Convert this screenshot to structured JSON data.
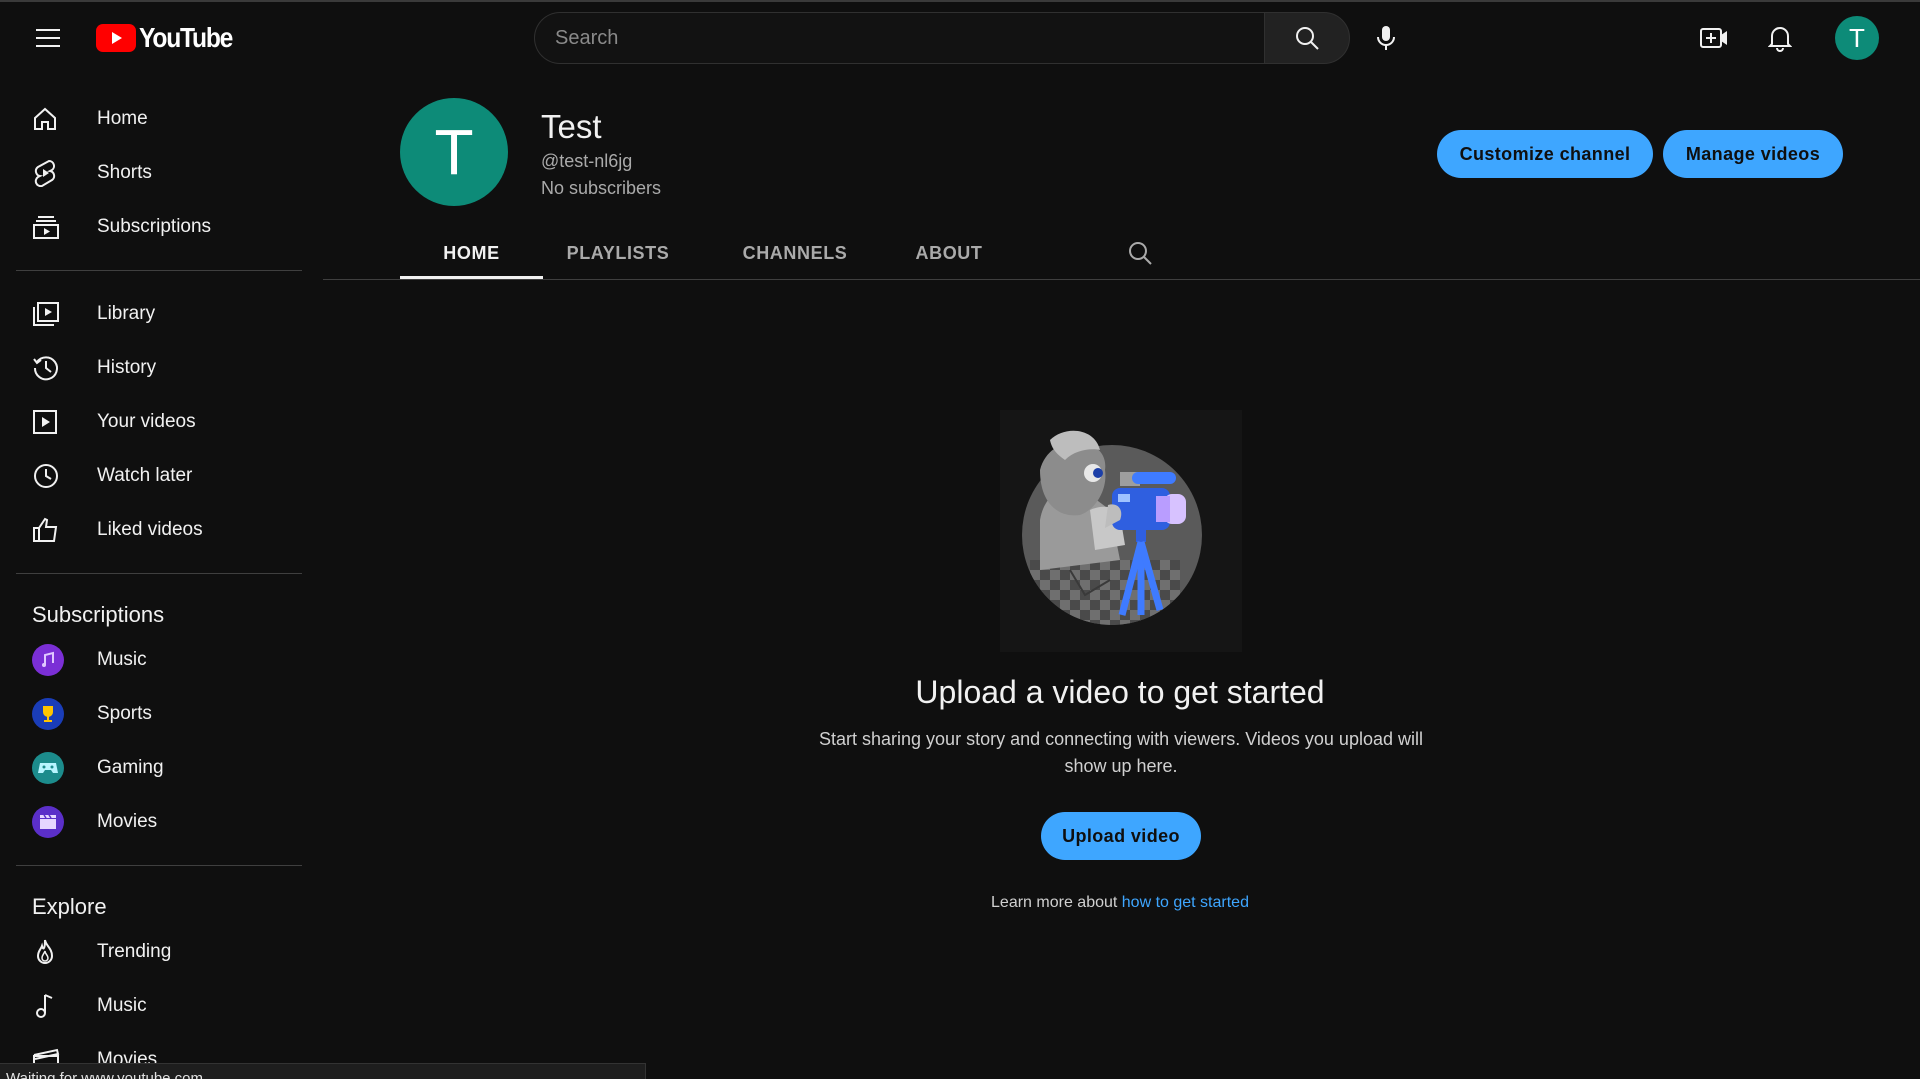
{
  "header": {
    "logo_text": "YouTube",
    "search_placeholder": "Search"
  },
  "user": {
    "avatar_initial": "T"
  },
  "sidebar": {
    "main": [
      {
        "label": "Home",
        "icon": "home-icon"
      },
      {
        "label": "Shorts",
        "icon": "shorts-icon"
      },
      {
        "label": "Subscriptions",
        "icon": "subscriptions-icon"
      }
    ],
    "you": [
      {
        "label": "Library",
        "icon": "library-icon"
      },
      {
        "label": "History",
        "icon": "history-icon"
      },
      {
        "label": "Your videos",
        "icon": "your-videos-icon"
      },
      {
        "label": "Watch later",
        "icon": "watch-later-icon"
      },
      {
        "label": "Liked videos",
        "icon": "like-icon"
      }
    ],
    "subscriptions_title": "Subscriptions",
    "subscriptions": [
      {
        "label": "Music",
        "color": "#7b2fd6"
      },
      {
        "label": "Sports",
        "color": "#1a3db8"
      },
      {
        "label": "Gaming",
        "color": "#1c8c8c"
      },
      {
        "label": "Movies",
        "color": "#5b2fc9"
      }
    ],
    "explore_title": "Explore",
    "explore": [
      {
        "label": "Trending",
        "icon": "trending-icon"
      },
      {
        "label": "Music",
        "icon": "music-note-icon"
      },
      {
        "label": "Movies",
        "icon": "movies-icon"
      }
    ]
  },
  "channel": {
    "avatar_initial": "T",
    "name": "Test",
    "handle": "@test-nl6jg",
    "subscribers": "No subscribers",
    "customize_label": "Customize channel",
    "manage_label": "Manage videos",
    "tabs": [
      "HOME",
      "PLAYLISTS",
      "CHANNELS",
      "ABOUT"
    ],
    "active_tab": "HOME"
  },
  "empty_state": {
    "title": "Upload a video to get started",
    "description": "Start sharing your story and connecting with viewers. Videos you upload will show up here.",
    "upload_label": "Upload video",
    "learn_prefix": "Learn more about ",
    "learn_link": "how to get started"
  },
  "status_bar": "Waiting for www.youtube.com...",
  "colors": {
    "accent": "#3ea6ff",
    "avatar": "#0d8b78",
    "brand_red": "#ff0000",
    "background": "#0f0f0f"
  }
}
